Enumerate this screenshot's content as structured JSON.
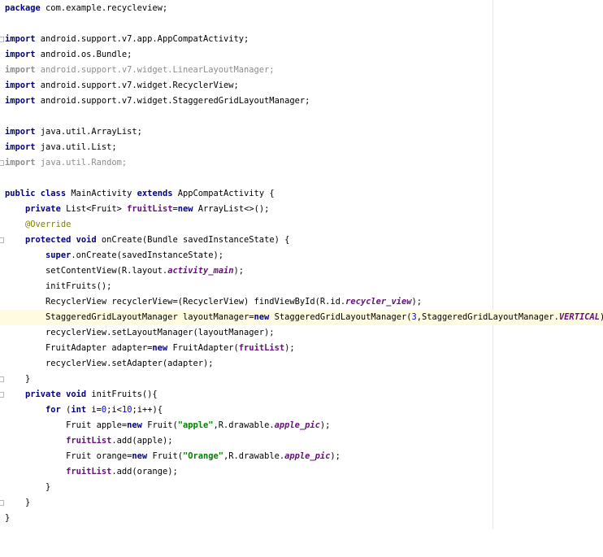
{
  "code": {
    "l1": {
      "kw": "package",
      "rest": " com.example.recycleview;"
    },
    "l3": {
      "kw": "import",
      "rest": " android.support.v7.app.AppCompatActivity;"
    },
    "l4": {
      "kw": "import",
      "rest": " android.os.Bundle;"
    },
    "l5": {
      "kw": "import",
      "rest": " android.support.v7.widget.LinearLayoutManager;"
    },
    "l6": {
      "kw": "import",
      "rest": " android.support.v7.widget.RecyclerView;"
    },
    "l7": {
      "kw": "import",
      "rest": " android.support.v7.widget.StaggeredGridLayoutManager;"
    },
    "l9": {
      "kw": "import",
      "rest": " java.util.ArrayList;"
    },
    "l10": {
      "kw": "import",
      "rest": " java.util.List;"
    },
    "l11": {
      "kw": "import",
      "rest": " java.util.Random;"
    },
    "l13": {
      "kw1": "public class",
      "mid": " MainActivity ",
      "kw2": "extends",
      "rest": " AppCompatActivity {"
    },
    "l14": {
      "kw1": "private",
      "mid": " List<Fruit> ",
      "fld": "fruitList",
      "eq": "=",
      "kw2": "new",
      "rest": " ArrayList<>();"
    },
    "l15": {
      "ann": "@Override"
    },
    "l16": {
      "kw": "protected void",
      "rest": " onCreate(Bundle savedInstanceState) {"
    },
    "l17": {
      "kw": "super",
      "rest": ".onCreate(savedInstanceState);"
    },
    "l18": {
      "pre": "setContentView(R.layout.",
      "sfld": "activity_main",
      "post": ");"
    },
    "l19": {
      "text": "initFruits();"
    },
    "l20": {
      "pre": "RecyclerView recyclerView=(RecyclerView) findViewById(R.id.",
      "sfld": "recycler_view",
      "post": ");"
    },
    "l21": {
      "pre": "StaggeredGridLayoutManager layoutManager=",
      "kw": "new",
      "mid": " StaggeredGridLayoutManager(",
      "num": "3",
      "mid2": ",StaggeredGridLayoutManager.",
      "sfld": "VERTICAL",
      "post": ");"
    },
    "l22": {
      "text": "recyclerView.setLayoutManager(layoutManager);"
    },
    "l23": {
      "pre": "FruitAdapter adapter=",
      "kw": "new",
      "mid": " FruitAdapter(",
      "fld": "fruitList",
      "post": ");"
    },
    "l24": {
      "text": "recyclerView.setAdapter(adapter);"
    },
    "l25": {
      "text": "}"
    },
    "l26": {
      "kw": "private void",
      "rest": " initFruits(){"
    },
    "l27": {
      "kw1": "for",
      "a": " (",
      "kw2": "int",
      "b": " i=",
      "n1": "0",
      "c": ";i<",
      "n2": "10",
      "d": ";i++){"
    },
    "l28": {
      "pre": "Fruit apple=",
      "kw": "new",
      "mid": " Fruit(",
      "str": "\"apple\"",
      "mid2": ",R.drawable.",
      "sfld": "apple_pic",
      "post": ");"
    },
    "l29": {
      "fld": "fruitList",
      "post": ".add(apple);"
    },
    "l30": {
      "pre": "Fruit orange=",
      "kw": "new",
      "mid": " Fruit(",
      "str": "\"Orange\"",
      "mid2": ",R.drawable.",
      "sfld": "apple_pic",
      "post": ");"
    },
    "l31": {
      "fld": "fruitList",
      "post": ".add(orange);"
    },
    "l32": {
      "text": "}"
    },
    "l33": {
      "text": "}"
    },
    "l34": {
      "text": "}"
    }
  }
}
